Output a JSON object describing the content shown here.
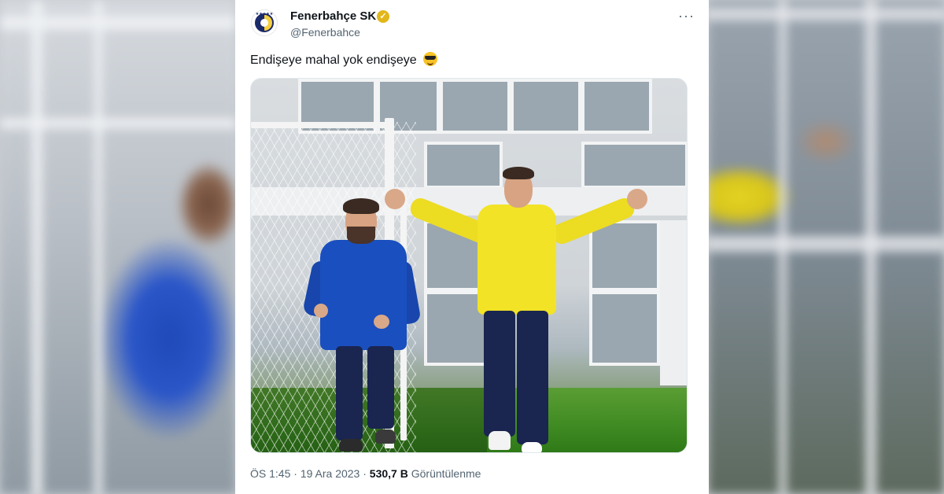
{
  "tweet": {
    "display_name": "Fenerbahçe SK",
    "handle": "@Fenerbahce",
    "text": "Endişeye mahal yok endişeye",
    "more_label": "···",
    "verified_mark": "✓",
    "emoji": "smiling-face-with-sunglasses",
    "time": "ÖS 1:45",
    "separator": "·",
    "date": "19 Ara 2023",
    "views_count": "530,7 B",
    "views_label": "Görüntülenme"
  },
  "colors": {
    "text_primary": "#0f1419",
    "text_secondary": "#536471",
    "verified_gold": "#e2b719",
    "card_background": "#ffffff"
  }
}
